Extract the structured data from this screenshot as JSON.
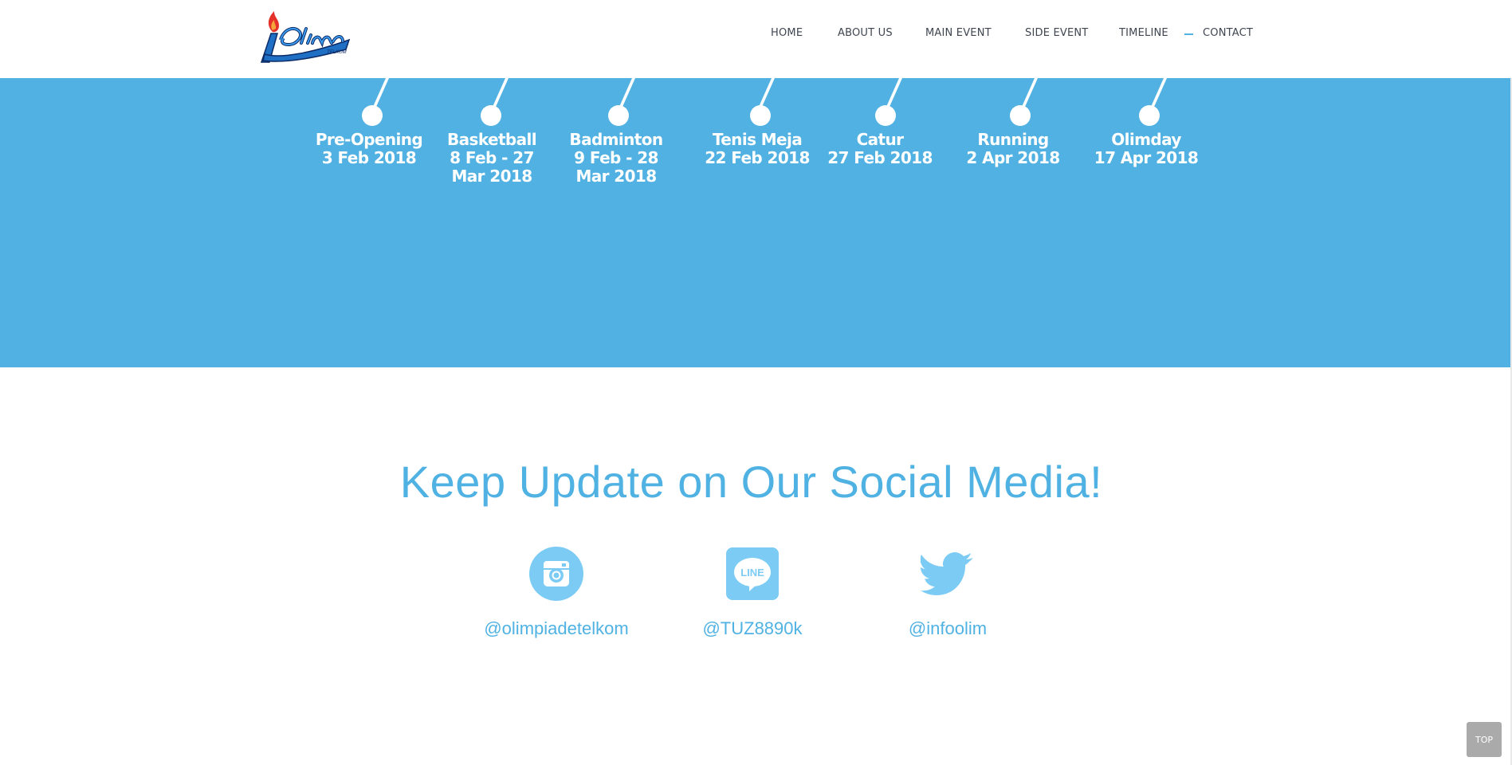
{
  "header": {
    "logo_alt": "Olimpiade Telkom logo",
    "nav": [
      {
        "label": "HOME",
        "active": false
      },
      {
        "label": "ABOUT US",
        "active": false
      },
      {
        "label": "MAIN EVENT",
        "active": false
      },
      {
        "label": "SIDE EVENT",
        "active": false
      },
      {
        "label": "TIMELINE",
        "active": false
      },
      {
        "label": "CONTACT",
        "active": true
      }
    ]
  },
  "timeline": {
    "items": [
      {
        "name": "Pre-Opening",
        "date": "3 Feb 2018"
      },
      {
        "name": "Basketball",
        "date": "8 Feb - 27 Mar 2018"
      },
      {
        "name": "Badminton",
        "date": "9 Feb - 28 Mar 2018"
      },
      {
        "name": "Tenis Meja",
        "date": "22 Feb 2018"
      },
      {
        "name": "Catur",
        "date": "27 Feb 2018"
      },
      {
        "name": "Running",
        "date": "2 Apr 2018"
      },
      {
        "name": "Olimday",
        "date": "17 Apr 2018"
      }
    ]
  },
  "social": {
    "title": "Keep Update on Our Social Media!",
    "accounts": [
      {
        "icon": "instagram-icon",
        "handle": "@olimpiadetelkom"
      },
      {
        "icon": "line-icon",
        "icon_text": "LINE",
        "handle": "@TUZ8890k"
      },
      {
        "icon": "twitter-icon",
        "handle": "@infoolim"
      }
    ]
  },
  "back_to_top": {
    "label": "TOP"
  },
  "colors": {
    "accent": "#4fb2e3",
    "band": "#51b1e3",
    "icon": "#7ccbf5",
    "nav_text": "#3f4650"
  }
}
